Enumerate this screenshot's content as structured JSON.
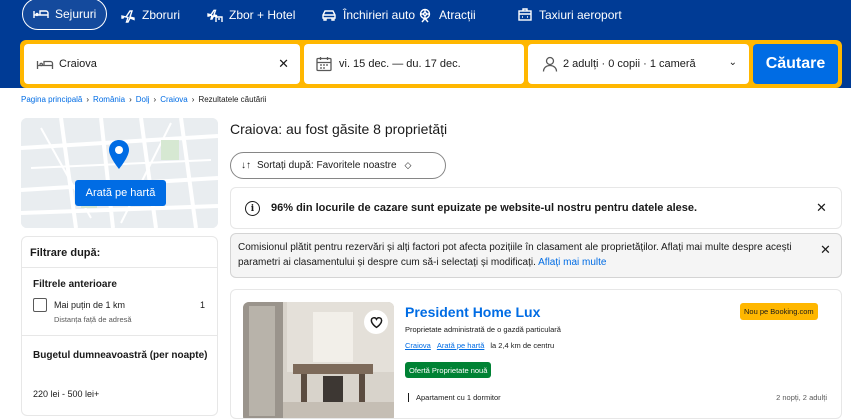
{
  "nav": {
    "tabs": [
      {
        "label": "Sejururi",
        "icon": "bed-icon",
        "active": true
      },
      {
        "label": "Zboruri",
        "icon": "plane-icon"
      },
      {
        "label": "Zbor + Hotel",
        "icon": "plane-hotel-icon"
      },
      {
        "label": "Închirieri auto",
        "icon": "car-icon"
      },
      {
        "label": "Atracții",
        "icon": "attraction-icon"
      },
      {
        "label": "Taxiuri aeroport",
        "icon": "taxi-icon"
      }
    ]
  },
  "search": {
    "destination": "Craiova",
    "dates": "vi. 15 dec. — du. 17 dec.",
    "guests": "2 adulți · 0 copii · 1 cameră",
    "button_label": "Căutare"
  },
  "breadcrumb": [
    "Pagina principală",
    "România",
    "Dolj",
    "Craiova",
    "Rezultatele căutării"
  ],
  "sidebar": {
    "map_button": "Arată pe hartă",
    "filter_heading": "Filtrare după:",
    "previous_filters_title": "Filtrele anterioare",
    "filter_option": {
      "label": "Mai puțin de 1 km",
      "count": "1",
      "description": "Distanța față de adresă"
    },
    "budget_title": "Bugetul dumneavoastră (per noapte)",
    "budget_range": "220 lei - 500 lei+"
  },
  "main": {
    "results_title": "Craiova: au fost găsite 8 proprietăți",
    "sort_label": "Sortați după: Favoritele noastre",
    "alert_sold_out": "96% din locurile de cazare sunt epuizate pe website-ul nostru pentru datele alese.",
    "commission_text": "Comisionul plătit pentru rezervări și alți factori pot afecta pozițiile în clasament ale proprietăților. Aflați mai multe despre acești parametri ai clasamentului și despre cum să-i selectați și modificați.",
    "commission_link": "Aflați mai multe"
  },
  "property": {
    "name": "President Home Lux",
    "managed_by": "Proprietate administrată de o gazdă particulară",
    "city_link": "Craiova",
    "map_link": "Arată pe hartă",
    "distance": "la 2,4 km de centru",
    "offer_badge": "Ofertă Proprietate nouă",
    "new_badge": "Nou pe Booking.com",
    "room_type": "Apartament cu 1 dormitor",
    "stay_info": "2 nopți, 2 adulți"
  },
  "colors": {
    "brand_blue": "#003b95",
    "search_yellow": "#ffb700",
    "action_blue": "#006ce4",
    "offer_green": "#008234"
  }
}
